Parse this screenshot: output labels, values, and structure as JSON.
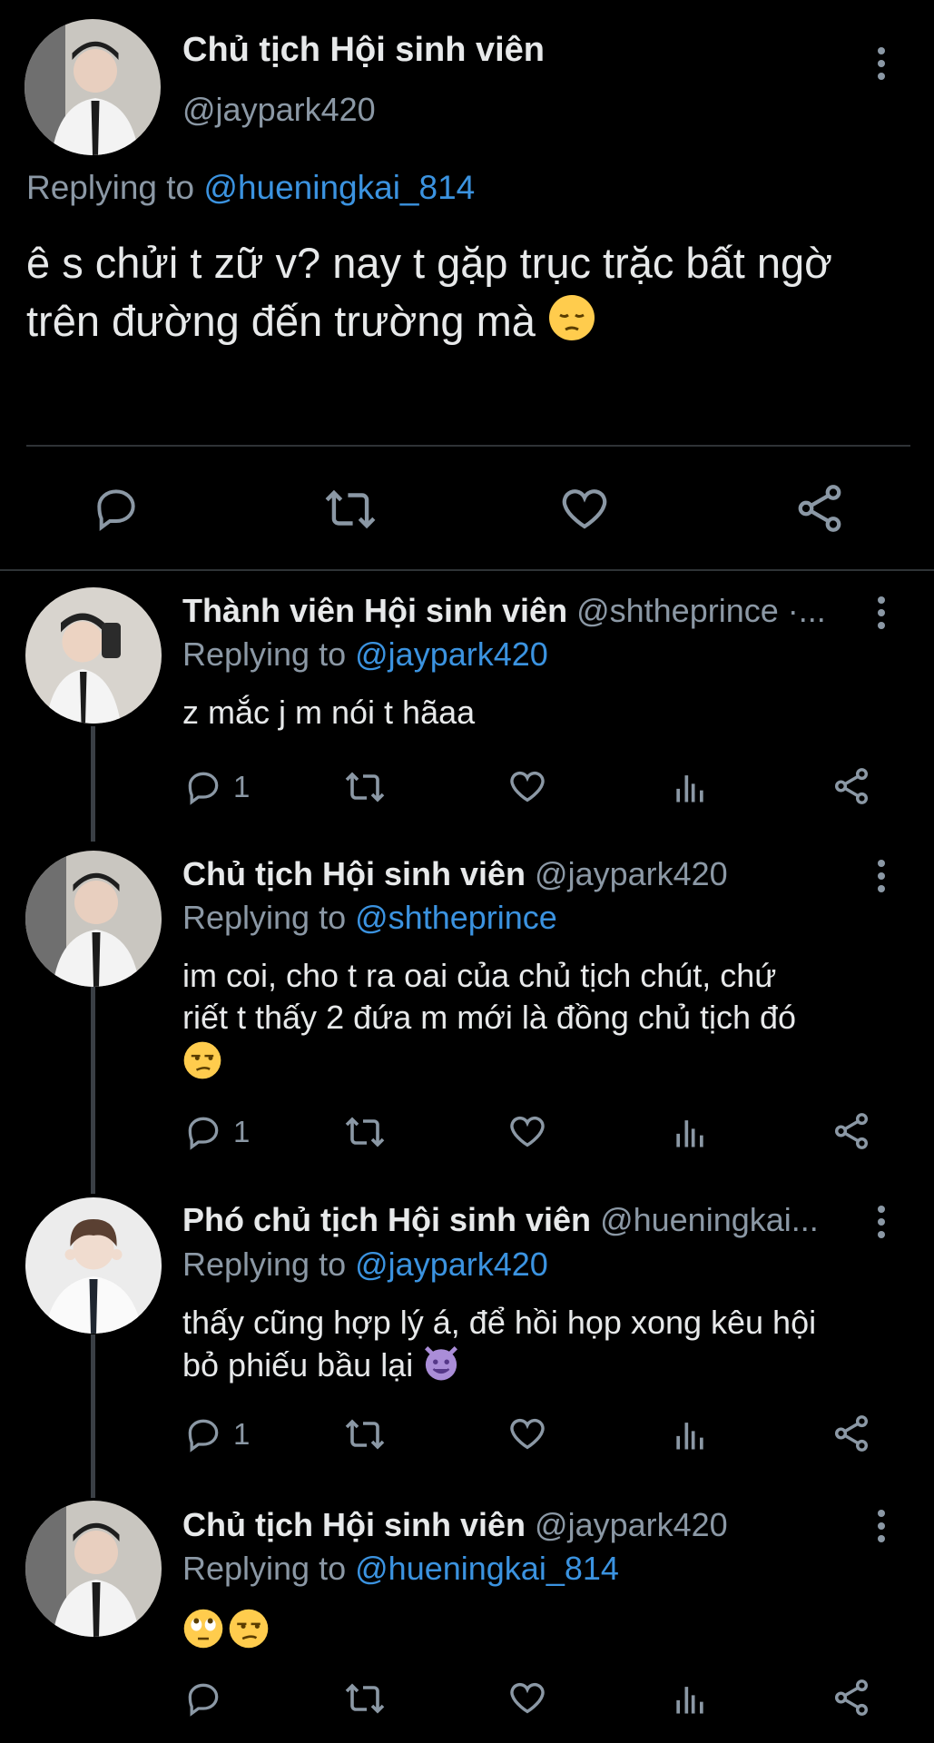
{
  "main_tweet": {
    "display_name": "Chủ tịch Hội sinh viên",
    "handle": "@jaypark420",
    "replying_prefix": "Replying to",
    "replying_to": "@hueningkai_814",
    "text_line1": "ê s chửi t zữ v? nay t gặp trục trặc bất ngờ",
    "text_line2": "trên đường đến trường mà",
    "text_emoji": "pensive-face"
  },
  "replies": [
    {
      "display_name": "Thành viên Hội sinh viên",
      "handle": "@shtheprince ·...",
      "replying_prefix": "Replying to",
      "replying_to": "@jaypark420",
      "text_line1": "z mắc j m nói t hãaa",
      "text_line2": "",
      "reply_count": "1"
    },
    {
      "display_name": "Chủ tịch Hội sinh viên",
      "handle": "@jaypark420",
      "replying_prefix": "Replying to",
      "replying_to": "@shtheprince",
      "text_line1": "im coi, cho t ra oai của chủ tịch chút, chứ",
      "text_line2": "riết t thấy 2 đứa m mới là đồng chủ tịch đó",
      "text_emoji": "unamused-face",
      "reply_count": "1"
    },
    {
      "display_name": "Phó chủ tịch Hội sinh viên",
      "handle": "@hueningkai...",
      "replying_prefix": "Replying to",
      "replying_to": "@jaypark420",
      "text_line1": "thấy cũng hợp lý á, để hồi họp xong kêu hội",
      "text_line2": "bỏ phiếu bầu lại",
      "text_emoji": "smiling-imp",
      "reply_count": "1"
    },
    {
      "display_name": "Chủ tịch Hội sinh viên",
      "handle": "@jaypark420",
      "replying_prefix": "Replying to",
      "replying_to": "@hueningkai_814",
      "text_emoji": "rolling-eyes-and-unamused",
      "reply_count": ""
    }
  ],
  "colors": {
    "background": "#000000",
    "text": "#e7e9ea",
    "muted": "#8b98a5",
    "link": "#3b93e0"
  }
}
